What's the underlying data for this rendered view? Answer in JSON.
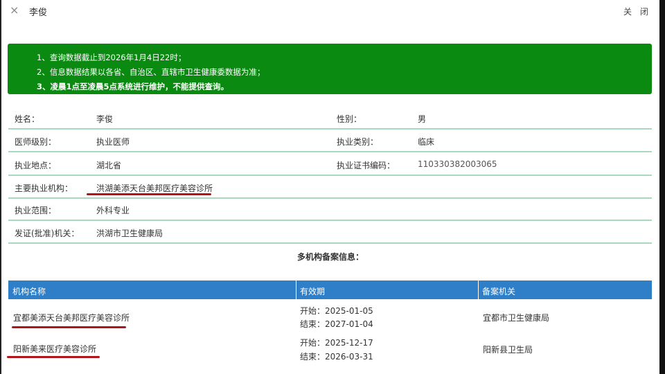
{
  "header": {
    "close_x": "×",
    "title": "李俊",
    "close_label": "关 闭"
  },
  "notice": {
    "color": "#0b8a12",
    "lines": [
      "1、查询数据截止到2026年1月4日22时；",
      "2、信息数据结果以各省、自治区、直辖市卫生健康委数据为准；",
      "3、凌晨1点至凌晨5点系统进行维护，不能提供查询。"
    ]
  },
  "info": [
    {
      "label": "姓名：",
      "value": "李俊",
      "label2": "性别：",
      "value2": "男"
    },
    {
      "label": "医师级别：",
      "value": "执业医师",
      "label2": "执业类别：",
      "value2": "临床"
    },
    {
      "label": "执业地点：",
      "value": "湖北省",
      "label2": "执业证书编码：",
      "value2": "110330382003065"
    },
    {
      "label": "主要执业机构：",
      "value": "洪湖美添天台美邦医疗美容诊所"
    },
    {
      "label": "执业范围：",
      "value": "外科专业"
    },
    {
      "label": "发证(批准)机关：",
      "value": "洪湖市卫生健康局"
    }
  ],
  "multi": {
    "title": "多机构备案信息：",
    "headers": [
      "机构名称",
      "有效期",
      "备案机关"
    ],
    "rows": [
      {
        "name": "宜都美添天台美邦医疗美容诊所",
        "start": "开始：2025-01-05",
        "end": "结束：2027-01-04",
        "org": "宜都市卫生健康局"
      },
      {
        "name": "阳新美来医疗美容诊所",
        "start": "开始：2025-12-17",
        "end": "结束：2026-03-31",
        "org": "阳新县卫生局"
      }
    ]
  }
}
